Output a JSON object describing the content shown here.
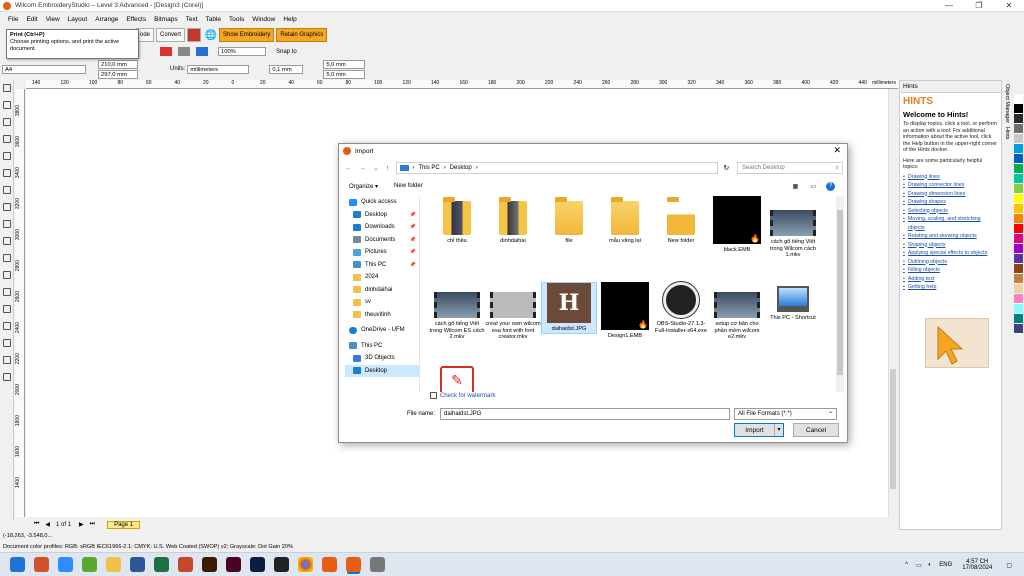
{
  "window": {
    "title": "Wilcom EmbroideryStudio – Level 3 Advanced - [Design3 (Corel)]",
    "controls": [
      "—",
      "❐",
      "✕"
    ]
  },
  "menu": [
    "File",
    "Edit",
    "View",
    "Layout",
    "Arrange",
    "Effects",
    "Bitmaps",
    "Text",
    "Table",
    "Tools",
    "Window",
    "Help"
  ],
  "toolbar": {
    "code_label": "ode",
    "convert_label": "Convert",
    "show_embroidery": "Show Embroidery",
    "retain_graphics": "Retain Graphics",
    "zoom": "100%",
    "snap_to": "Snap to",
    "page_size": "A4",
    "width": "210,0 mm",
    "height": "297,0 mm",
    "units_label": "Units:",
    "units_value": "millimeters",
    "nudge": "0,1 mm",
    "dup_x": "5,0 mm",
    "dup_y": "5,0 mm"
  },
  "tooltip": {
    "title": "Print (Ctrl+P)",
    "body": "Choose printing options, and print the active document."
  },
  "ruler": {
    "labels": [
      "140",
      "120",
      "100",
      "80",
      "60",
      "40",
      "20",
      "0",
      "20",
      "40",
      "60",
      "80",
      "100",
      "120",
      "140",
      "160",
      "180",
      "200",
      "220",
      "240",
      "260",
      "280",
      "300",
      "320",
      "340",
      "360",
      "380",
      "400",
      "420",
      "440"
    ],
    "unit": "millimeters",
    "vlabels": [
      "3800",
      "3600",
      "3400",
      "3200",
      "3000",
      "2800",
      "2600",
      "2400",
      "2200",
      "2000",
      "1800",
      "1600",
      "1400"
    ]
  },
  "pages": {
    "counter": "1 of 1",
    "tab": "Page 1"
  },
  "status": {
    "coords": "(-18,263, -3.548,0...",
    "profiles": "Document color profiles: RGB: sRGB IEC61966-2.1; CMYK: U.S. Web Coated (SWOP) v2; Grayscale: Dot Gain 20%"
  },
  "hints": {
    "header": "Hints",
    "title": "HINTS",
    "welcome": "Welcome to Hints!",
    "para1": "To display topics, click a tool, or perform an action with a tool. For additional information about the active tool, click the Help button in the upper-right corner of the Hints docker.",
    "para2": "Here are some particularly helpful topics:",
    "links": [
      "Drawing lines",
      "Drawing connector lines",
      "Drawing dimension lines",
      "Drawing shapes",
      "Selecting objects",
      "Moving, scaling, and stretching objects",
      "Rotating and skewing objects",
      "Shaping objects",
      "Applying special effects to objects",
      "Outlining objects",
      "Filling objects",
      "Adding text",
      "Getting help"
    ]
  },
  "docker_tabs": [
    "Object Manager",
    "Hints"
  ],
  "dialog": {
    "title": "Import",
    "path": [
      "This PC",
      "Desktop"
    ],
    "search_placeholder": "Search Desktop",
    "organize": "Organize ▾",
    "new_folder": "New folder",
    "nav": [
      {
        "label": "Quick access",
        "color": "#1e90ff",
        "pin": false
      },
      {
        "label": "Desktop",
        "color": "#1a7fd4",
        "pin": true
      },
      {
        "label": "Downloads",
        "color": "#1a7fd4",
        "pin": true
      },
      {
        "label": "Documents",
        "color": "#7a8896",
        "pin": true
      },
      {
        "label": "Pictures",
        "color": "#4aa3df",
        "pin": true
      },
      {
        "label": "This PC",
        "color": "#4a90c8",
        "pin": true
      },
      {
        "label": "2024",
        "color": "#f1c14b",
        "pin": false
      },
      {
        "label": "dinhdaihai",
        "color": "#f1c14b",
        "pin": false
      },
      {
        "label": "sv",
        "color": "#f1c14b",
        "pin": false
      },
      {
        "label": "theuvitinh",
        "color": "#f1c14b",
        "pin": false
      },
      {
        "label": "OneDrive - UFM",
        "color": "#1a7fd4",
        "pin": false
      },
      {
        "label": "This PC",
        "color": "#4a90c8",
        "pin": false
      },
      {
        "label": "3D Objects",
        "color": "#3a7bd5",
        "pin": false
      },
      {
        "label": "Desktop",
        "color": "#1a7fd4",
        "pin": false
      }
    ],
    "files": [
      {
        "name": "chỉ thêu",
        "kind": "folder"
      },
      {
        "name": "dinhdaihai",
        "kind": "folder"
      },
      {
        "name": "file",
        "kind": "folder"
      },
      {
        "name": "mẫu vãng lai",
        "kind": "folder"
      },
      {
        "name": "New folder",
        "kind": "folder"
      },
      {
        "name": "black.EMB",
        "kind": "emb"
      },
      {
        "name": "cách gõ tiếng Việt trong Wilcom cách 1.mkv",
        "kind": "video"
      },
      {
        "name": "cách gõ tiếng Việt trong Wilcom ES cách 2.mkv",
        "kind": "video"
      },
      {
        "name": "creat your own wilcom esa font with font creator.mkv",
        "kind": "video"
      },
      {
        "name": "daihaidst.JPG",
        "kind": "jpg"
      },
      {
        "name": "Design1.EMB",
        "kind": "emb"
      },
      {
        "name": "OBS-Studio-27.1.3-Full-Installer-x64.exe",
        "kind": "obs"
      },
      {
        "name": "setup cơ bản cho phần mềm wilcom e2.mkv",
        "kind": "video"
      },
      {
        "name": "This PC - Shortcut",
        "kind": "pc"
      },
      {
        "name": "",
        "kind": "pdf"
      }
    ],
    "watermark": "Check for watermark",
    "filename_label": "File name:",
    "filename_value": "daihaidst.JPG",
    "filetype": "All File Formats (*.*)",
    "import_btn": "Import",
    "cancel_btn": "Cancel"
  },
  "taskbar": {
    "time": "4:57 CH",
    "date": "17/08/2024",
    "lang": "ENG"
  },
  "palette": [
    "#ffffff",
    "#000000",
    "#2b2b2b",
    "#6e6e6e",
    "#c8c8c8",
    "#00a0e0",
    "#0060c0",
    "#00b050",
    "#00c8a0",
    "#80d040",
    "#ffff00",
    "#ffc000",
    "#ff8000",
    "#ff0000",
    "#e00080",
    "#a000c0",
    "#6030a0",
    "#8b4513",
    "#c08040",
    "#f0d0a0",
    "#ff80c0",
    "#80ffff",
    "#008080",
    "#404080"
  ]
}
